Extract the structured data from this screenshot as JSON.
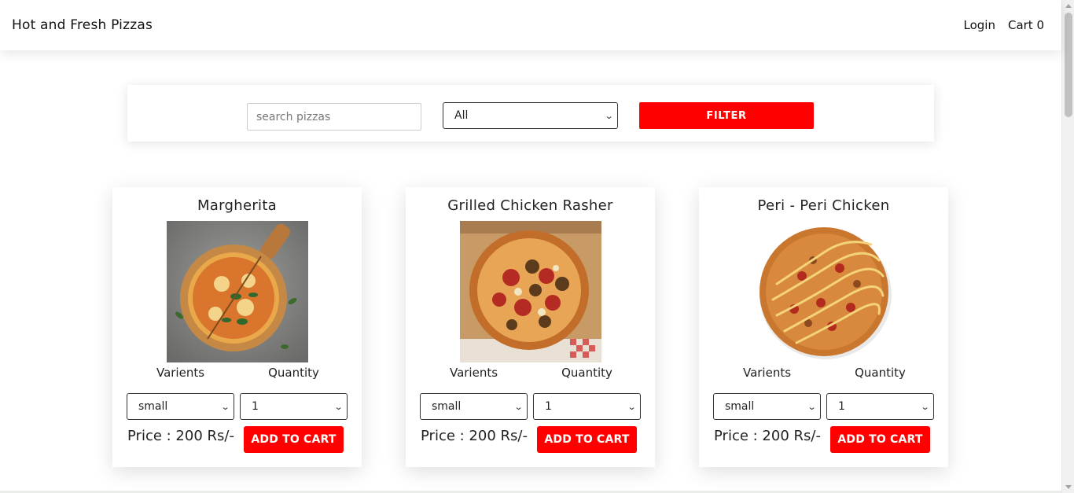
{
  "navbar": {
    "brand": "Hot and Fresh Pizzas",
    "login_label": "Login",
    "cart_label": "Cart 0"
  },
  "filter": {
    "search_placeholder": "search pizzas",
    "category_selected": "All",
    "filter_label": "FILTER"
  },
  "labels": {
    "variants": "Varients",
    "quantity": "Quantity",
    "add_to_cart": "ADD TO CART"
  },
  "pizzas": [
    {
      "name": "Margherita",
      "variant": "small",
      "quantity": "1",
      "price": "Price : 200 Rs/-",
      "image_icon": "margherita-pizza-photo"
    },
    {
      "name": "Grilled Chicken Rasher",
      "variant": "small",
      "quantity": "1",
      "price": "Price : 200 Rs/-",
      "image_icon": "grilled-chicken-pizza-photo"
    },
    {
      "name": "Peri - Peri Chicken",
      "variant": "small",
      "quantity": "1",
      "price": "Price : 200 Rs/-",
      "image_icon": "peri-peri-pizza-photo"
    }
  ],
  "colors": {
    "accent": "#ff0000",
    "background": "#ffffff"
  }
}
